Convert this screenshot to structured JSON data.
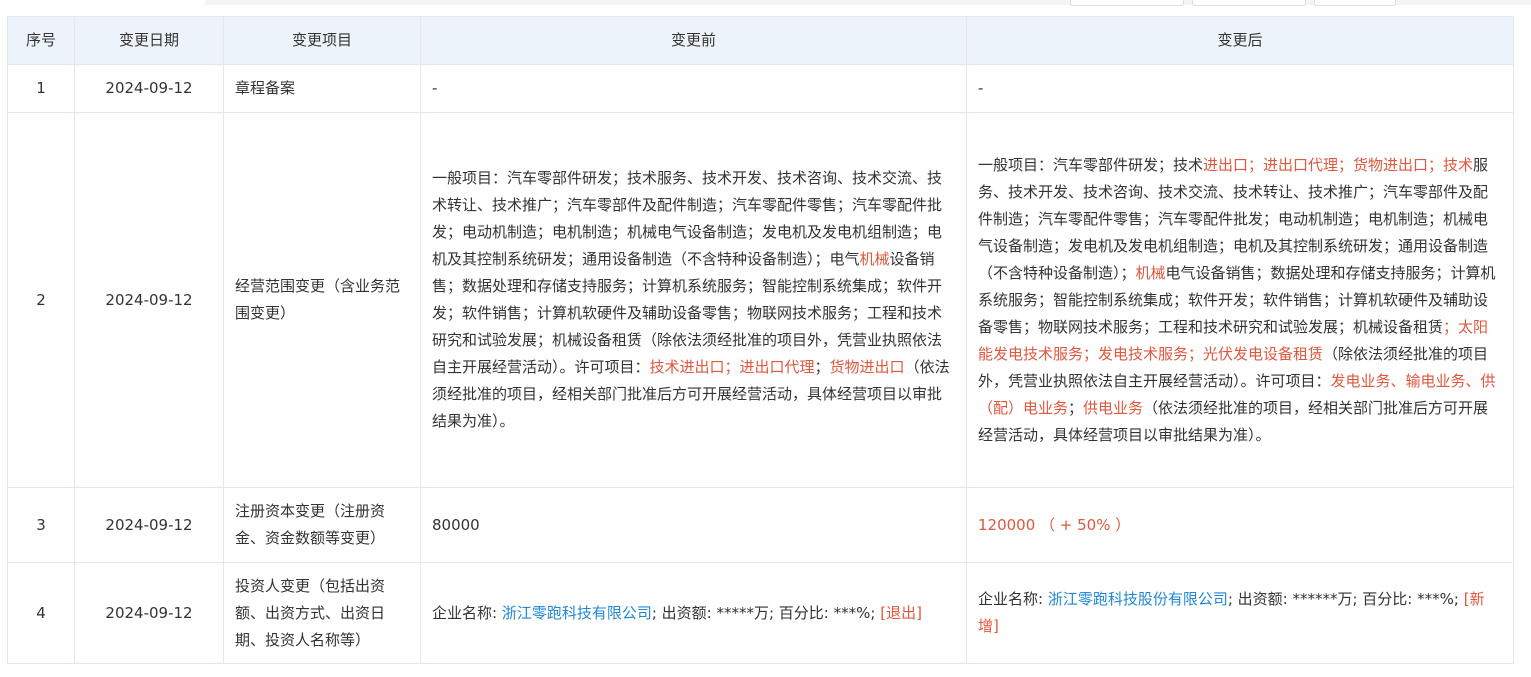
{
  "header": {
    "seq": "序号",
    "date": "变更日期",
    "item": "变更项目",
    "before": "变更前",
    "after": "变更后"
  },
  "rows": [
    {
      "seq": "1",
      "date": "2024-09-12",
      "item": "章程备案",
      "before": "-",
      "after": "-"
    },
    {
      "seq": "2",
      "date": "2024-09-12",
      "item": "经营范围变更（含业务范围变更）",
      "before": [
        {
          "t": "一般项目：汽车零部件研发；技术服务、技术开发、技术咨询、技术交流、技术转让、技术推广；汽车零部件及配件制造；汽车零配件零售；汽车零配件批发；电动机制造；电机制造；机械电气设备制造；发电机及发电机组制造；电机及其控制系统研发；通用设备制造（不含特种设备制造）；电气"
        },
        {
          "t": "机械",
          "hl": true
        },
        {
          "t": "设备销售；数据处理和存储支持服务；计算机系统服务；智能控制系统集成；软件开发；软件销售；计算机软硬件及辅助设备零售；物联网技术服务；工程和技术研究和试验发展；机械设备租赁（除依法须经批准的项目外，凭营业执照依法自主开展经营活动）。许可项目："
        },
        {
          "t": "技术进出口；进出口代理",
          "hl": true
        },
        {
          "t": "；"
        },
        {
          "t": "货物进出口",
          "hl": true
        },
        {
          "t": "（依法须经批准的项目，经相关部门批准后方可开展经营活动，具体经营项目以审批结果为准）。"
        }
      ],
      "after": [
        {
          "t": "一般项目：汽车零部件研发；技术"
        },
        {
          "t": "进出口；进出口代理；货物进出口；技术",
          "hl": true
        },
        {
          "t": "服务、技术开发、技术咨询、技术交流、技术转让、技术推广；汽车零部件及配件制造；汽车零配件零售；汽车零配件批发；电动机制造；电机制造；机械电气设备制造；发电机及发电机组制造；电机及其控制系统研发；通用设备制造（不含特种设备制造）；"
        },
        {
          "t": "机械",
          "hl": true
        },
        {
          "t": "电气设备销售；数据处理和存储支持服务；计算机系统服务；智能控制系统集成；软件开发；软件销售；计算机软硬件及辅助设备零售；物联网技术服务；工程和技术研究和试验发展；机械设备租赁"
        },
        {
          "t": "；太阳能发电技术服务；发电技术服务；光伏发电设备租赁",
          "hl": true
        },
        {
          "t": "（除依法须经批准的项目外，凭营业执照依法自主开展经营活动）。许可项目："
        },
        {
          "t": "发电业务、输电业务、供（配）电业务",
          "hl": true
        },
        {
          "t": "；"
        },
        {
          "t": "供电业务",
          "hl": true
        },
        {
          "t": "（依法须经批准的项目，经相关部门批准后方可开展经营活动，具体经营项目以审批结果为准）。"
        }
      ]
    },
    {
      "seq": "3",
      "date": "2024-09-12",
      "item": "注册资本变更（注册资金、资金数额等变更）",
      "before": "80000",
      "after": "120000 （ + 50% ）"
    },
    {
      "seq": "4",
      "date": "2024-09-12",
      "item": "投资人变更（包括出资额、出资方式、出资日期、投资人名称等）",
      "before": {
        "name_label": "企业名称: ",
        "name": "浙江零跑科技有限公司",
        "rest": "; 出资额: *****万; 百分比: ***%; ",
        "tag": "[退出]"
      },
      "after": {
        "name_label": "企业名称: ",
        "name": "浙江零跑科技股份有限公司",
        "rest": "; 出资额: ******万; 百分比: ***%; ",
        "tag": "[新增]"
      }
    }
  ]
}
